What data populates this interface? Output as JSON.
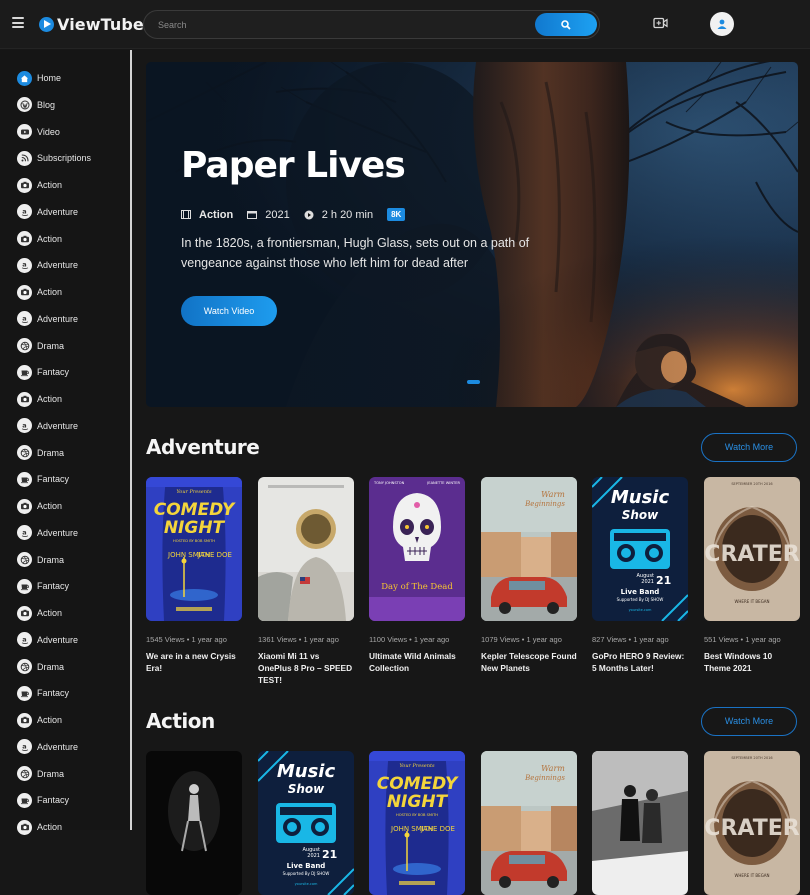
{
  "app": {
    "name": "ViewTube"
  },
  "search": {
    "placeholder": "Search"
  },
  "sidebar": {
    "items": [
      {
        "label": "Home",
        "icon": "home-icon",
        "active": true
      },
      {
        "label": "Blog",
        "icon": "wordpress-icon"
      },
      {
        "label": "Video",
        "icon": "youtube-icon"
      },
      {
        "label": "Subscriptions",
        "icon": "rss-icon"
      },
      {
        "label": "Action",
        "icon": "camera-icon"
      },
      {
        "label": "Adventure",
        "icon": "amazon-icon"
      },
      {
        "label": "Action",
        "icon": "camera-icon"
      },
      {
        "label": "Adventure",
        "icon": "amazon-icon"
      },
      {
        "label": "Action",
        "icon": "camera-icon"
      },
      {
        "label": "Adventure",
        "icon": "amazon-icon"
      },
      {
        "label": "Drama",
        "icon": "dribbble-icon"
      },
      {
        "label": "Fantacy",
        "icon": "coffee-icon"
      },
      {
        "label": "Action",
        "icon": "camera-icon"
      },
      {
        "label": "Adventure",
        "icon": "amazon-icon"
      },
      {
        "label": "Drama",
        "icon": "dribbble-icon"
      },
      {
        "label": "Fantacy",
        "icon": "coffee-icon"
      },
      {
        "label": "Action",
        "icon": "camera-icon"
      },
      {
        "label": "Adventure",
        "icon": "amazon-icon"
      },
      {
        "label": "Drama",
        "icon": "dribbble-icon"
      },
      {
        "label": "Fantacy",
        "icon": "coffee-icon"
      },
      {
        "label": "Action",
        "icon": "camera-icon"
      },
      {
        "label": "Adventure",
        "icon": "amazon-icon"
      },
      {
        "label": "Drama",
        "icon": "dribbble-icon"
      },
      {
        "label": "Fantacy",
        "icon": "coffee-icon"
      },
      {
        "label": "Action",
        "icon": "camera-icon"
      },
      {
        "label": "Adventure",
        "icon": "amazon-icon"
      },
      {
        "label": "Drama",
        "icon": "dribbble-icon"
      },
      {
        "label": "Fantacy",
        "icon": "coffee-icon"
      },
      {
        "label": "Action",
        "icon": "camera-icon"
      }
    ]
  },
  "hero": {
    "title": "Paper Lives",
    "genre": "Action",
    "year": "2021",
    "duration": "2 h 20 min",
    "quality": "8K",
    "description": "In the 1820s, a frontiersman, Hugh Glass, sets out on a path of vengeance against those who left him for dead after",
    "button": "Watch Video"
  },
  "sections": [
    {
      "title": "Adventure",
      "more_label": "Watch More",
      "cards": [
        {
          "views": "1545 Views",
          "age": "1 year ago",
          "title": "We are in a new Crysis Era!",
          "poster": "comedy-night"
        },
        {
          "views": "1361 Views",
          "age": "1 year ago",
          "title": "Xiaomi Mi 11 vs OnePlus 8 Pro – SPEED TEST!",
          "poster": "astronaut"
        },
        {
          "views": "1100 Views",
          "age": "1 year ago",
          "title": "Ultimate Wild Animals Collection",
          "poster": "day-of-the-dead"
        },
        {
          "views": "1079 Views",
          "age": "1 year ago",
          "title": "Kepler Telescope Found New Planets",
          "poster": "warm-beginnings"
        },
        {
          "views": "827 Views",
          "age": "1 year ago",
          "title": "GoPro HERO 9 Review: 5 Months Later!",
          "poster": "music-show"
        },
        {
          "views": "551 Views",
          "age": "1 year ago",
          "title": "Best Windows 10 Theme 2021",
          "poster": "crater"
        }
      ]
    },
    {
      "title": "Action",
      "more_label": "Watch More",
      "cards": [
        {
          "poster": "dark-dancer"
        },
        {
          "poster": "music-show"
        },
        {
          "poster": "comedy-night"
        },
        {
          "poster": "warm-beginnings"
        },
        {
          "poster": "bw-couple"
        },
        {
          "poster": "crater"
        }
      ]
    }
  ],
  "posters": {
    "comedy_title_1": "COMEDY",
    "comedy_title_2": "NIGHT",
    "comedy_kicker": "Your Presents",
    "comedy_host": "HOSTED BY BOB SMITH",
    "comedy_name_1": "JOHN SMITH",
    "comedy_name_2": "JANE DOE",
    "dead_top_left": "TONY JOHNSTON",
    "dead_top_right": "JEANETTE WINTER",
    "dead_title": "Day of The Dead",
    "warm_line_1": "Warm",
    "warm_line_2": "Beginnings",
    "music_line_1": "Music",
    "music_line_2": "Show",
    "music_band": "Live Band",
    "music_dj": "Supported By DJ SHOW",
    "music_date_month": "August",
    "music_date_day": "21",
    "music_date_year": "2021",
    "music_site": "yoursite.com",
    "crater_date": "SEPTEMBER 20TH 2016",
    "crater_title": "CRATER",
    "crater_tag": "WHERE IT BEGAN"
  }
}
